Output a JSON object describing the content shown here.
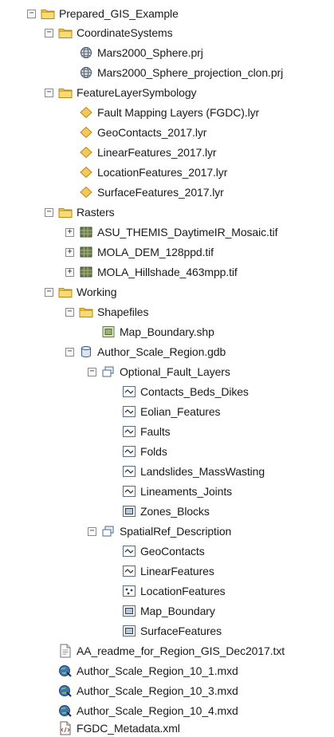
{
  "tree": [
    {
      "label": "Prepared_GIS_Example",
      "icon": "folder-icon",
      "level": 0,
      "expander": "minus"
    },
    {
      "label": "CoordinateSystems",
      "icon": "folder-icon",
      "level": 1,
      "expander": "minus"
    },
    {
      "label": "Mars2000_Sphere.prj",
      "icon": "globe-icon",
      "level": 2,
      "expander": "none"
    },
    {
      "label": "Mars2000_Sphere_projection_clon.prj",
      "icon": "globe-icon",
      "level": 2,
      "expander": "none"
    },
    {
      "label": "FeatureLayerSymbology",
      "icon": "folder-icon",
      "level": 1,
      "expander": "minus"
    },
    {
      "label": "Fault Mapping Layers (FGDC).lyr",
      "icon": "layer-file-icon",
      "level": 2,
      "expander": "none"
    },
    {
      "label": "GeoContacts_2017.lyr",
      "icon": "layer-file-icon",
      "level": 2,
      "expander": "none"
    },
    {
      "label": "LinearFeatures_2017.lyr",
      "icon": "layer-file-icon",
      "level": 2,
      "expander": "none"
    },
    {
      "label": "LocationFeatures_2017.lyr",
      "icon": "layer-file-icon",
      "level": 2,
      "expander": "none"
    },
    {
      "label": "SurfaceFeatures_2017.lyr",
      "icon": "layer-file-icon",
      "level": 2,
      "expander": "none"
    },
    {
      "label": "Rasters",
      "icon": "folder-icon",
      "level": 1,
      "expander": "minus"
    },
    {
      "label": "ASU_THEMIS_DaytimeIR_Mosaic.tif",
      "icon": "raster-icon",
      "level": 2,
      "expander": "plus"
    },
    {
      "label": "MOLA_DEM_128ppd.tif",
      "icon": "raster-icon",
      "level": 2,
      "expander": "plus"
    },
    {
      "label": "MOLA_Hillshade_463mpp.tif",
      "icon": "raster-icon",
      "level": 2,
      "expander": "plus"
    },
    {
      "label": "Working",
      "icon": "folder-icon",
      "level": 1,
      "expander": "minus"
    },
    {
      "label": "Shapefiles",
      "icon": "folder-icon",
      "level": 2,
      "expander": "minus"
    },
    {
      "label": "Map_Boundary.shp",
      "icon": "shapefile-icon",
      "level": 3,
      "expander": "none"
    },
    {
      "label": "Author_Scale_Region.gdb",
      "icon": "geodatabase-icon",
      "level": 2,
      "expander": "minus"
    },
    {
      "label": "Optional_Fault_Layers",
      "icon": "feature-dataset-icon",
      "level": 3,
      "expander": "minus"
    },
    {
      "label": "Contacts_Beds_Dikes",
      "icon": "line-feature-class-icon",
      "level": 4,
      "expander": "none"
    },
    {
      "label": "Eolian_Features",
      "icon": "line-feature-class-icon",
      "level": 4,
      "expander": "none"
    },
    {
      "label": "Faults",
      "icon": "line-feature-class-icon",
      "level": 4,
      "expander": "none"
    },
    {
      "label": "Folds",
      "icon": "line-feature-class-icon",
      "level": 4,
      "expander": "none"
    },
    {
      "label": "Landslides_MassWasting",
      "icon": "line-feature-class-icon",
      "level": 4,
      "expander": "none"
    },
    {
      "label": "Lineaments_Joints",
      "icon": "line-feature-class-icon",
      "level": 4,
      "expander": "none"
    },
    {
      "label": "Zones_Blocks",
      "icon": "polygon-feature-class-icon",
      "level": 4,
      "expander": "none"
    },
    {
      "label": "SpatialRef_Description",
      "icon": "feature-dataset-icon",
      "level": 3,
      "expander": "minus"
    },
    {
      "label": "GeoContacts",
      "icon": "line-feature-class-icon",
      "level": 4,
      "expander": "none"
    },
    {
      "label": "LinearFeatures",
      "icon": "line-feature-class-icon",
      "level": 4,
      "expander": "none"
    },
    {
      "label": "LocationFeatures",
      "icon": "point-feature-class-icon",
      "level": 4,
      "expander": "none"
    },
    {
      "label": "Map_Boundary",
      "icon": "polygon-feature-class-icon",
      "level": 4,
      "expander": "none"
    },
    {
      "label": "SurfaceFeatures",
      "icon": "polygon-feature-class-icon",
      "level": 4,
      "expander": "none"
    },
    {
      "label": "AA_readme_for_Region_GIS_Dec2017.txt",
      "icon": "text-file-icon",
      "level": 1,
      "expander": "none"
    },
    {
      "label": "Author_Scale_Region_10_1.mxd",
      "icon": "map-document-icon",
      "level": 1,
      "expander": "none"
    },
    {
      "label": "Author_Scale_Region_10_3.mxd",
      "icon": "map-document-icon",
      "level": 1,
      "expander": "none"
    },
    {
      "label": "Author_Scale_Region_10_4.mxd",
      "icon": "map-document-icon",
      "level": 1,
      "expander": "none"
    },
    {
      "label": "FGDC_Metadata.xml",
      "icon": "xml-file-icon",
      "level": 1,
      "expander": "none"
    }
  ]
}
